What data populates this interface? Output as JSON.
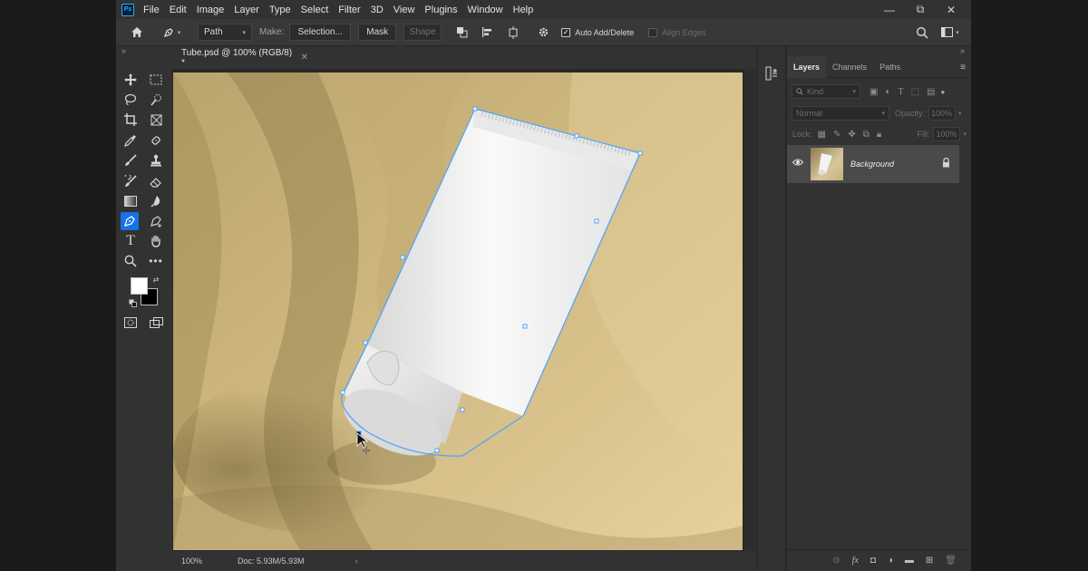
{
  "app": {
    "logo": "Ps"
  },
  "menu": [
    "File",
    "Edit",
    "Image",
    "Layer",
    "Type",
    "Select",
    "Filter",
    "3D",
    "View",
    "Plugins",
    "Window",
    "Help"
  ],
  "window_controls": {
    "minimize": "—",
    "restore": "⧉",
    "close": "✕"
  },
  "options": {
    "mode_value": "Path",
    "make_label": "Make:",
    "selection_button": "Selection...",
    "mask_button": "Mask",
    "shape_button": "Shape",
    "auto_add_delete_label": "Auto Add/Delete",
    "auto_add_delete_checked": true,
    "align_edges_label": "Align Edges",
    "align_edges_checked": false
  },
  "document": {
    "tab_title": "Tube.psd @ 100% (RGB/8) *",
    "zoom": "100%",
    "doc_size": "Doc: 5.93M/5.93M"
  },
  "tools": {
    "active": "pen-tool",
    "foreground_color": "#ffffff",
    "background_color": "#000000"
  },
  "layers_panel": {
    "tabs": [
      "Layers",
      "Channels",
      "Paths"
    ],
    "active_tab": "Layers",
    "filter_placeholder": "Kind",
    "blend_mode": "Normal",
    "opacity_label": "Opacity:",
    "opacity_value": "100%",
    "lock_label": "Lock:",
    "fill_label": "Fill:",
    "fill_value": "100%",
    "layers": [
      {
        "name": "Background",
        "visible": true,
        "locked": true
      }
    ]
  },
  "colors": {
    "accent": "#1473e6",
    "path_stroke": "#4aa3ff",
    "fabric": "#c9b27a",
    "tube": "#f2f2f2"
  }
}
